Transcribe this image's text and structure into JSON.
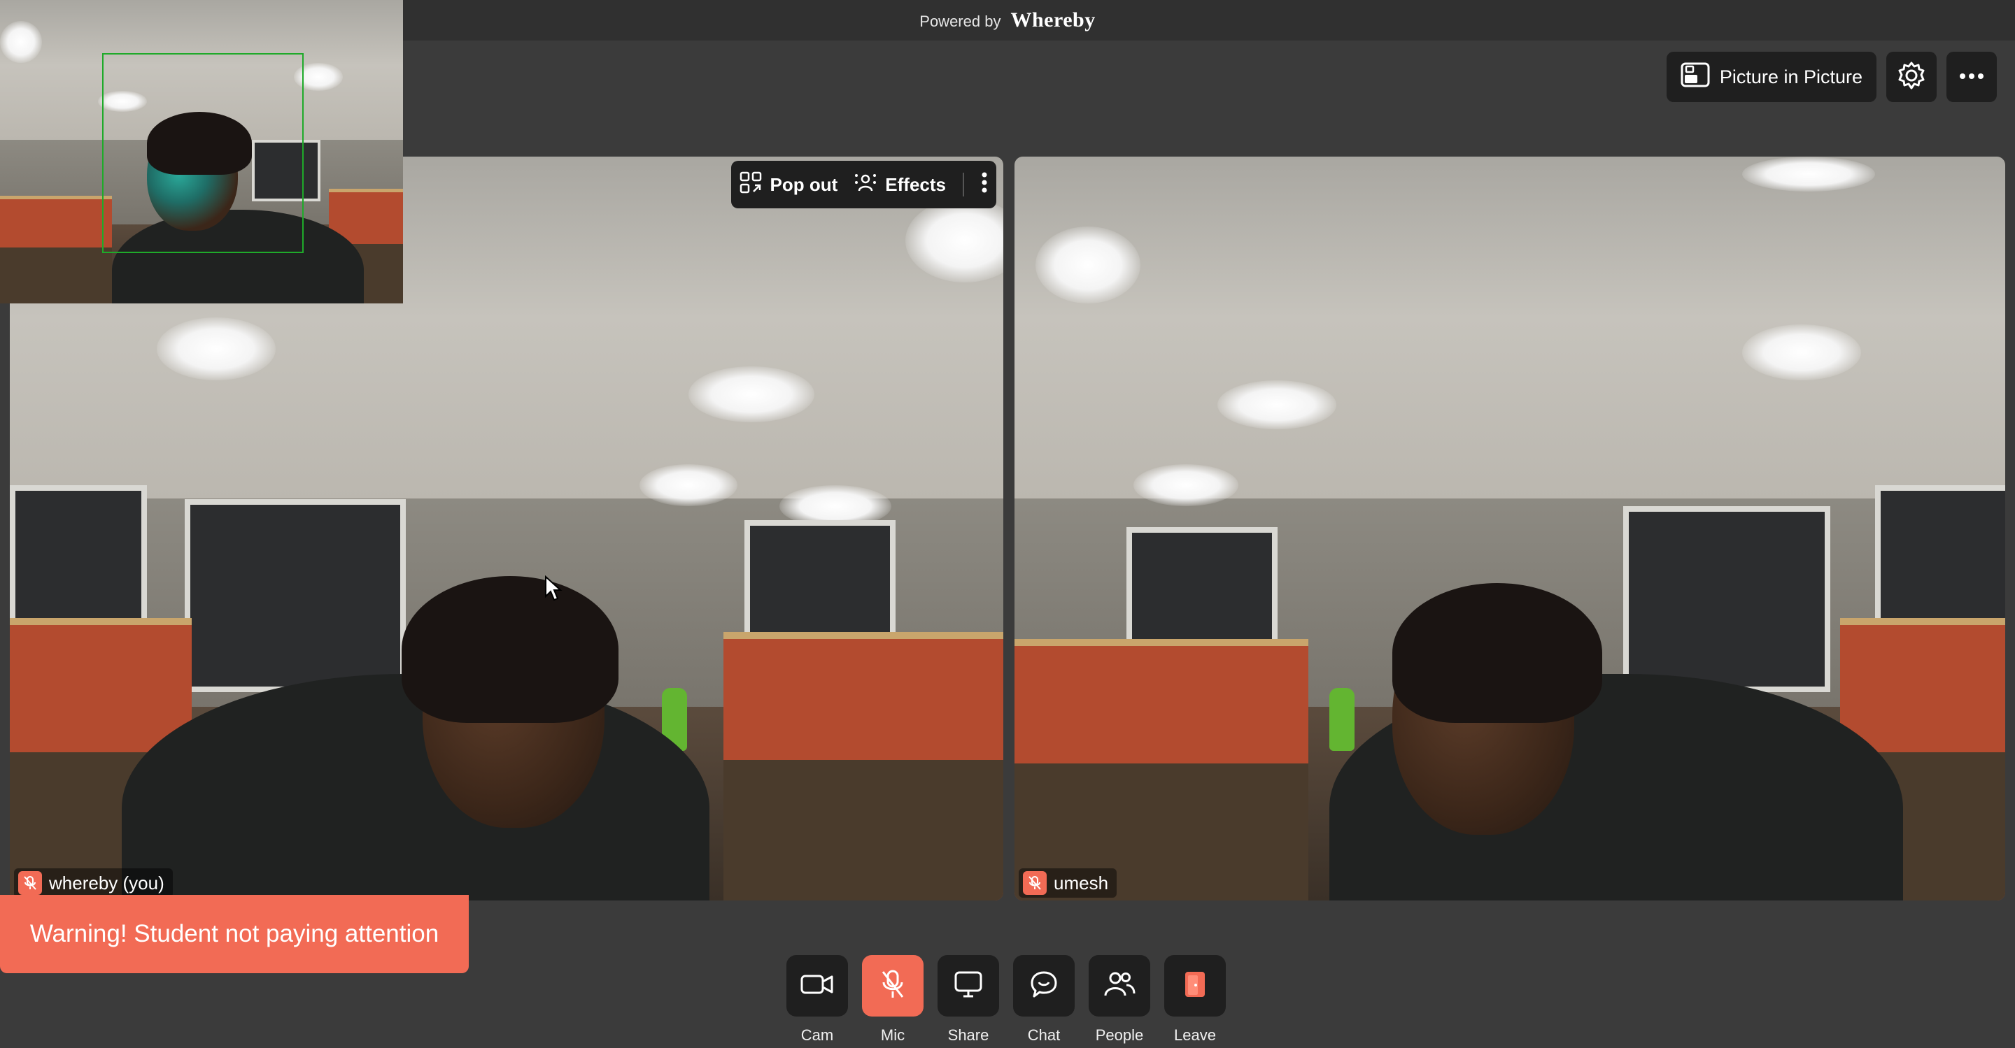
{
  "header": {
    "powered_by": "Powered by",
    "brand": "Whereby"
  },
  "top_actions": {
    "pip_label": "Picture in Picture",
    "settings_icon": "gear-icon",
    "more_icon": "ellipsis-icon"
  },
  "tile_toolbar": {
    "pop_out": "Pop out",
    "effects": "Effects"
  },
  "participants": [
    {
      "name": "whereby (you)",
      "muted": true
    },
    {
      "name": "umesh",
      "muted": true
    }
  ],
  "warning": {
    "text": "Warning! Student not paying attention"
  },
  "controls": [
    {
      "label": "Cam",
      "icon": "camera-icon",
      "active": false
    },
    {
      "label": "Mic",
      "icon": "mic-off-icon",
      "active": true
    },
    {
      "label": "Share",
      "icon": "screen-share-icon",
      "active": false
    },
    {
      "label": "Chat",
      "icon": "chat-icon",
      "active": false
    },
    {
      "label": "People",
      "icon": "people-icon",
      "active": false
    },
    {
      "label": "Leave",
      "icon": "leave-icon",
      "active": false
    }
  ],
  "colors": {
    "accent": "#f26b55",
    "panel": "#1f1f1f",
    "background": "#3b3b3b",
    "facebox": "#1faa2a"
  }
}
